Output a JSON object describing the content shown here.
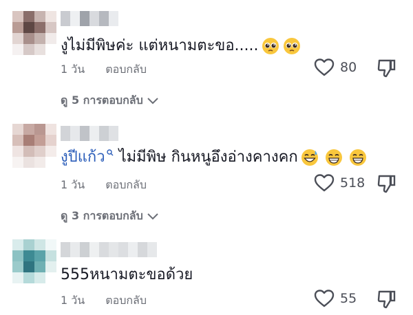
{
  "comments": [
    {
      "text_plain": "งูไม่มีพิษค่ะ แต่หนามตะขอ.....",
      "emojis": [
        "pleading-face",
        "pleading-face"
      ],
      "time": "1 วัน",
      "reply_label": "ตอบกลับ",
      "likes": "80",
      "view_replies": "ดู 5 การตอบกลับ"
    },
    {
      "text_link": "งูปีแก้ว",
      "text_plain": "ไม่มีพิษ กินหนูอึงอ่างคางคก",
      "emojis": [
        "grinning-sweat-face",
        "beaming-face",
        "beaming-face"
      ],
      "time": "1 วัน",
      "reply_label": "ตอบกลับ",
      "likes": "518",
      "view_replies": "ดู 3 การตอบกลับ"
    },
    {
      "text_plain": "555หนามตะขอด้วย",
      "emojis": [],
      "time": "1 วัน",
      "reply_label": "ตอบกลับ",
      "likes": "55"
    }
  ],
  "colors": {
    "link": "#2b5db9",
    "meta": "#6b6e76",
    "emoji_yellow": "#f9c73d"
  }
}
